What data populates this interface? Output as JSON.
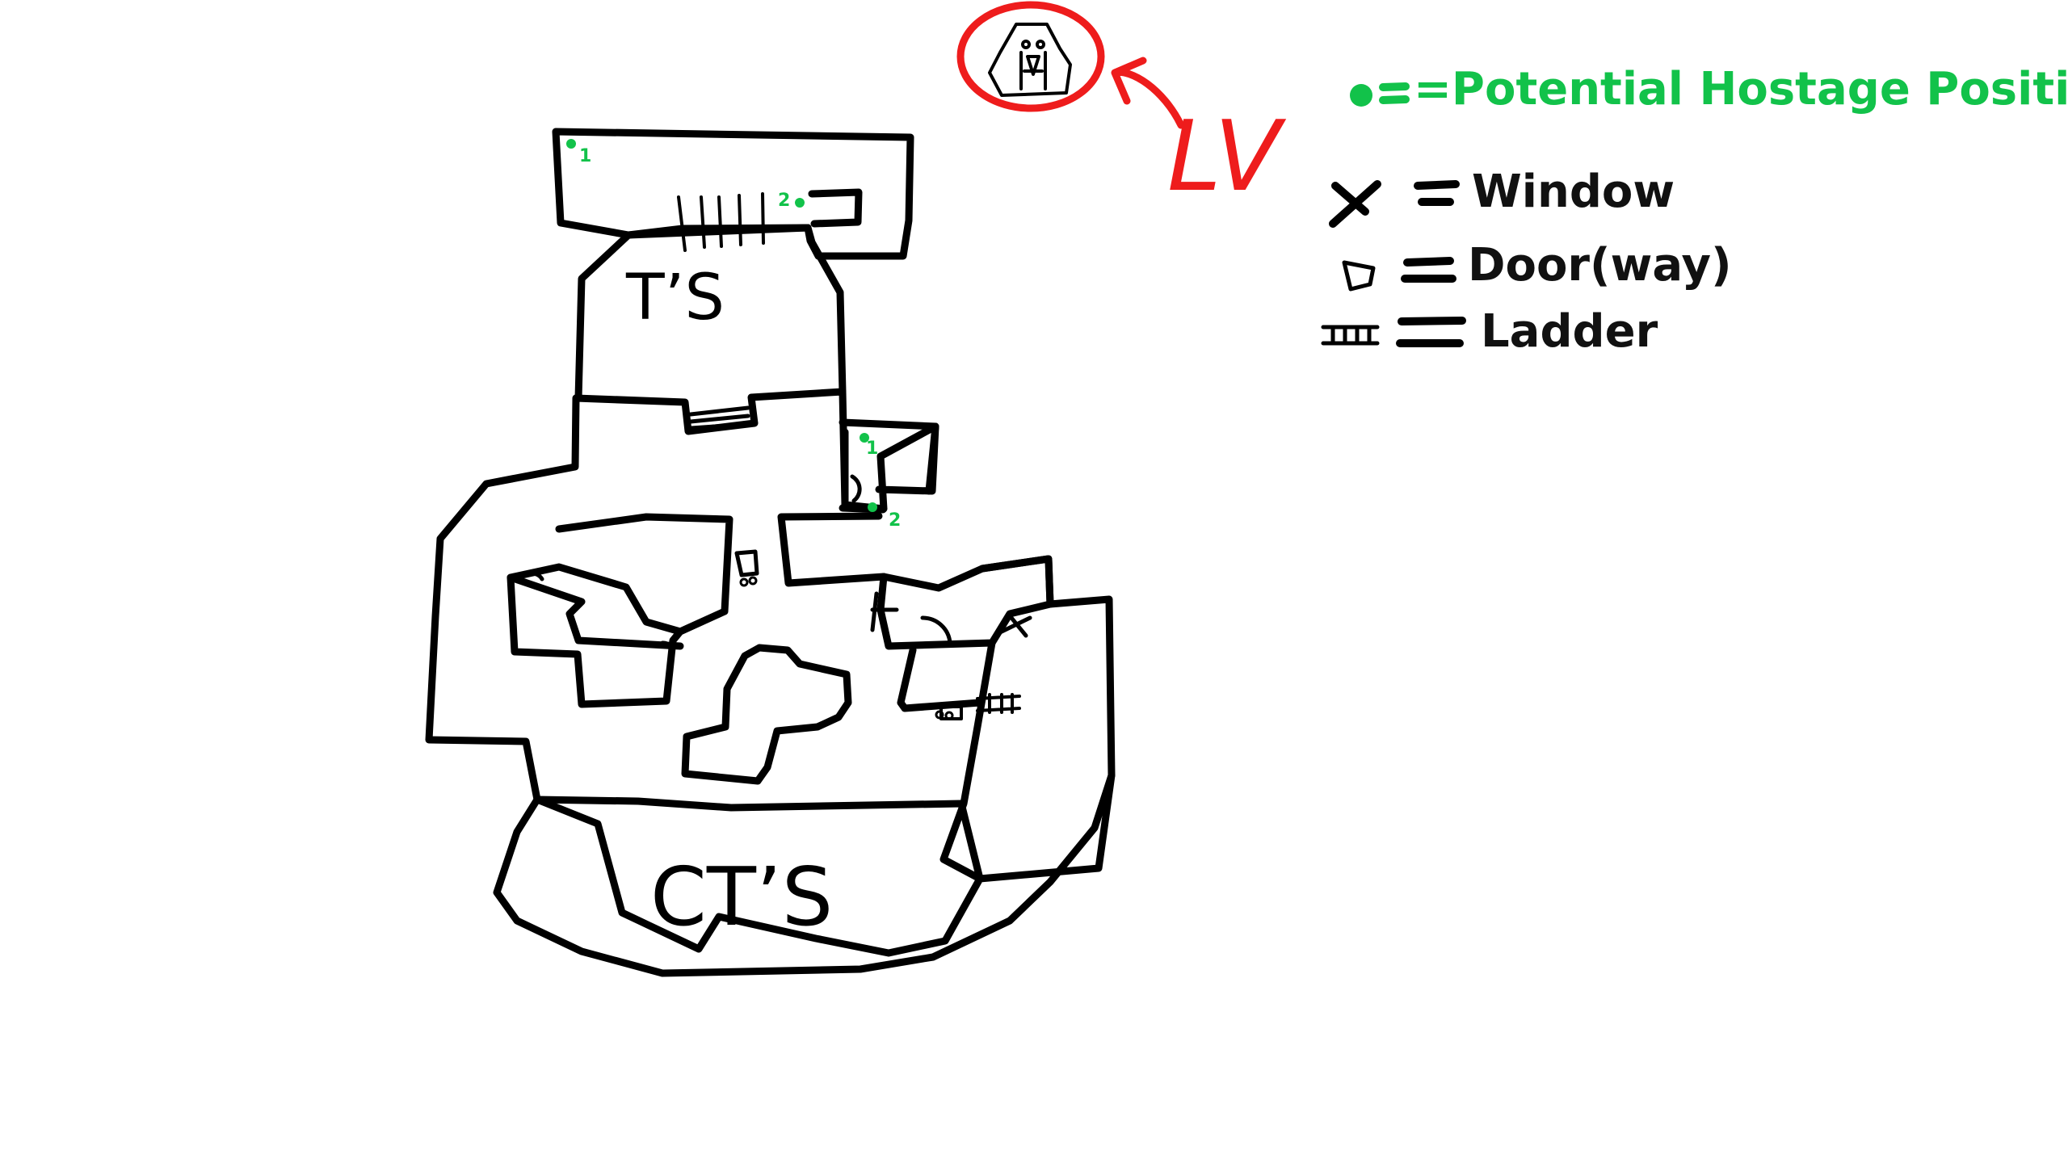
{
  "map": {
    "spawn_t_label": "T’S",
    "spawn_ct_label": "CT’S",
    "hostage_markers": [
      {
        "label": "1",
        "room": "top-corridor-left"
      },
      {
        "label": "2",
        "room": "top-corridor-right"
      },
      {
        "label": "1",
        "room": "side-room-top"
      },
      {
        "label": "2",
        "room": "side-room-bottom"
      }
    ]
  },
  "annotation": {
    "author_initials": "LV",
    "ink_color": "#ee1c1c",
    "logo": "hostage-face-logo"
  },
  "legend": {
    "hostage_label": "=Potential Hostage Positions",
    "hostage_color": "#12c24a",
    "window_label": "Window",
    "door_label": "Door(way)",
    "ladder_label": "Ladder",
    "window_icon": "cross-icon",
    "door_icon": "door-arc-icon",
    "ladder_icon": "ladder-icon"
  },
  "colors": {
    "wall_ink": "#000000",
    "background": "#ffffff"
  }
}
